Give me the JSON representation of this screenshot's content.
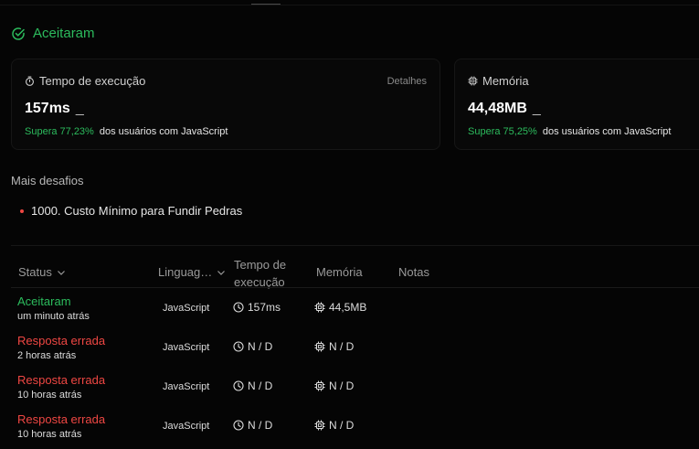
{
  "status_header": {
    "label": "Aceitaram"
  },
  "runtime": {
    "title": "Tempo de execução",
    "details_label": "Detalhes",
    "value": "157ms",
    "cursor": "_",
    "beats": "Supera 77,23%",
    "compare_text": "dos usuários com JavaScript"
  },
  "memory": {
    "title": "Memória",
    "value": "44,48MB",
    "cursor": "_",
    "beats": "Supera 75,25%",
    "compare_text": "dos usuários com JavaScript"
  },
  "more_challenges": {
    "heading": "Mais desafios",
    "items": [
      "1000. Custo Mínimo para Fundir Pedras"
    ]
  },
  "table": {
    "headers": {
      "status": "Status",
      "language": "Linguag…",
      "time_line1": "Tempo de",
      "time_line2": "execução",
      "memory": "Memória",
      "notes": "Notas"
    },
    "rows": [
      {
        "status": "Aceitaram",
        "when": "um minuto atrás",
        "language": "JavaScript",
        "time": "157ms",
        "memory": "44,5MB"
      },
      {
        "status": "Resposta errada",
        "when": "2 horas atrás",
        "language": "JavaScript",
        "time": "N / D",
        "memory": "N / D"
      },
      {
        "status": "Resposta errada",
        "when": "10 horas atrás",
        "language": "JavaScript",
        "time": "N / D",
        "memory": "N / D"
      },
      {
        "status": "Resposta errada",
        "when": "10 horas atrás",
        "language": "JavaScript",
        "time": "N / D",
        "memory": "N / D"
      }
    ]
  },
  "colors": {
    "accepted": "#2cbb5d",
    "error": "#ef4743",
    "background": "#050505"
  }
}
